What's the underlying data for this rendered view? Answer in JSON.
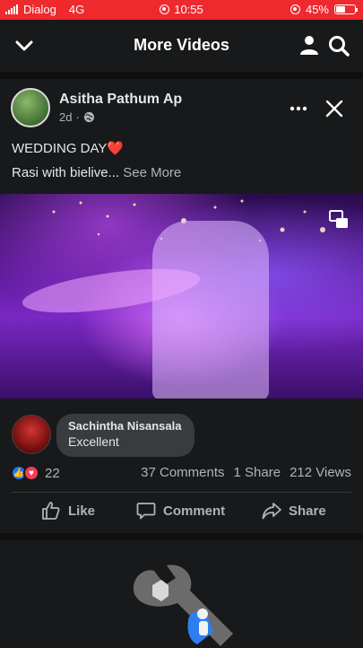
{
  "status_bar": {
    "carrier": "Dialog",
    "network": "4G",
    "time": "10:55",
    "battery": "45%",
    "battery_level": 0.45,
    "accent_color": "#ee2a2f"
  },
  "topbar": {
    "title": "More Videos",
    "icons": [
      "chevron-down-icon",
      "profile-icon",
      "search-icon"
    ]
  },
  "post": {
    "author": "Asitha Pathum Ap",
    "time": "2d",
    "audience_icon": "globe-icon",
    "text": "WEDDING DAY",
    "text_emoji": "❤️",
    "subtext": "Rasi with bielive...",
    "see_more": "See More"
  },
  "comment": {
    "name": "Sachintha Nisansala",
    "text": "Excellent"
  },
  "stats": {
    "reaction_count": "22",
    "comments": "37 Comments",
    "shares": "1 Share",
    "views": "212 Views"
  },
  "actions": {
    "like": "Like",
    "comment": "Comment",
    "share": "Share"
  }
}
